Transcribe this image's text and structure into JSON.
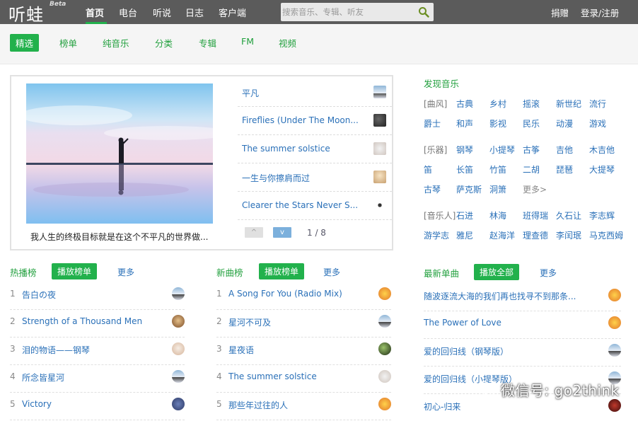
{
  "header": {
    "logo": "听蛙",
    "beta": "Beta",
    "nav": [
      "首页",
      "电台",
      "听说",
      "日志",
      "客户端"
    ],
    "search_placeholder": "搜索音乐、专辑、听友",
    "donate": "捐赠",
    "login": "登录/注册",
    "accent": "#22b14c"
  },
  "subnav": [
    "精选",
    "榜单",
    "纯音乐",
    "分类",
    "专辑",
    "FM",
    "视频"
  ],
  "featured": {
    "caption": "我人生的终极目标就是在这个不平凡的世界做...",
    "songs": [
      "平凡",
      "Fireflies (Under The Moon...",
      "The summer solstice",
      "一生与你擦肩而过",
      "Clearer the Stars Never S..."
    ],
    "pager_up": "^",
    "pager_down": "v",
    "page": "1 / 8"
  },
  "discover": {
    "title": "发现音乐",
    "genre_label": "[曲风]",
    "genres": [
      "古典",
      "乡村",
      "摇滚",
      "新世纪",
      "流行",
      "爵士",
      "和声",
      "影视",
      "民乐",
      "动漫",
      "游戏"
    ],
    "instrument_label": "[乐器]",
    "instruments": [
      "钢琴",
      "小提琴",
      "古筝",
      "吉他",
      "木吉他",
      "笛",
      "长笛",
      "竹笛",
      "二胡",
      "琵琶",
      "大提琴",
      "古琴",
      "萨克斯",
      "洞箫",
      "更多>"
    ],
    "artist_label": "[音乐人]",
    "artists": [
      "石进",
      "林海",
      "班得瑞",
      "久石让",
      "李志辉",
      "游学志",
      "雅尼",
      "赵海洋",
      "理查德",
      "李闰珉",
      "马克西姆"
    ]
  },
  "hot": {
    "title": "热播榜",
    "button": "播放榜单",
    "more": "更多",
    "items": [
      {
        "n": "1",
        "t": "告白の夜"
      },
      {
        "n": "2",
        "t": "Strength of a Thousand Men"
      },
      {
        "n": "3",
        "t": "泪的物语——钢琴"
      },
      {
        "n": "4",
        "t": "所念皆星河"
      },
      {
        "n": "5",
        "t": "Victory"
      }
    ]
  },
  "new": {
    "title": "新曲榜",
    "button": "播放榜单",
    "more": "更多",
    "items": [
      {
        "n": "1",
        "t": "A Song For You (Radio Mix)"
      },
      {
        "n": "2",
        "t": "星河不可及"
      },
      {
        "n": "3",
        "t": "星夜语"
      },
      {
        "n": "4",
        "t": "The summer solstice"
      },
      {
        "n": "5",
        "t": "那些年过往的人"
      }
    ]
  },
  "latest": {
    "title": "最新单曲",
    "button": "播放全部",
    "more": "更多",
    "items": [
      "随波逐流大海的我们再也找寻不到那条...",
      "The Power of Love",
      "爱的回归线（钢琴版）",
      "爱的回归线（小提琴版）",
      "初心-归来"
    ]
  },
  "watermark": "微信号: go2think"
}
